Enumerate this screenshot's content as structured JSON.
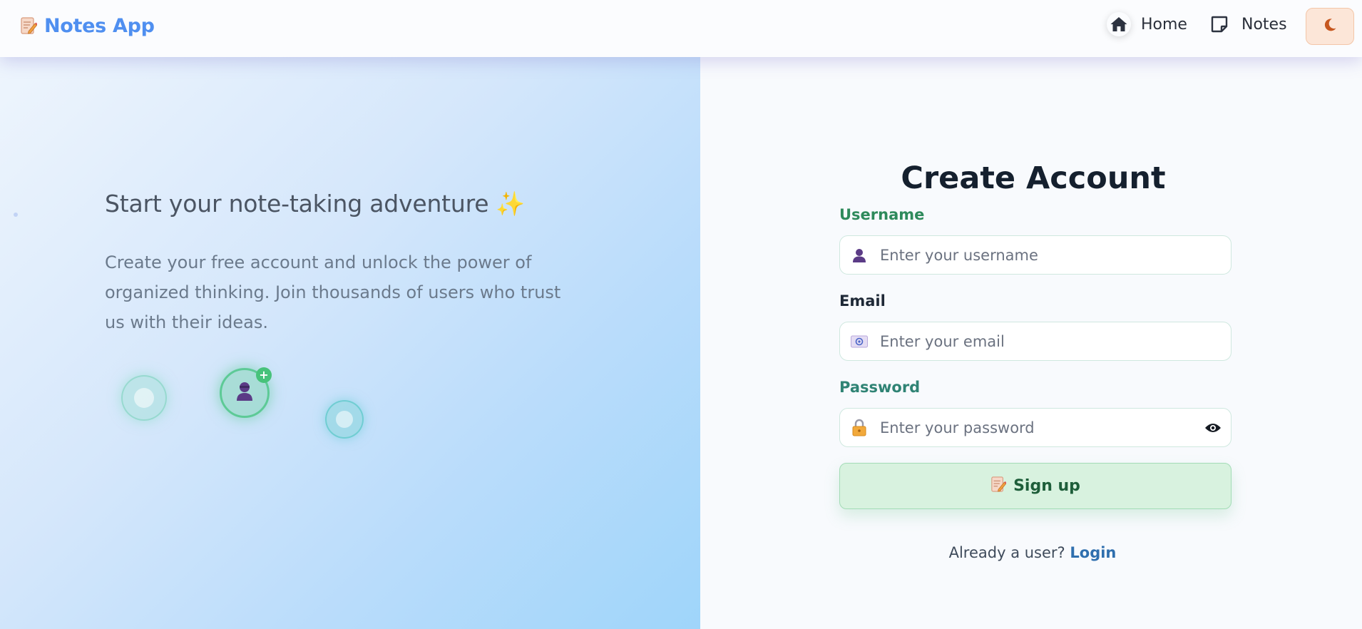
{
  "navbar": {
    "brand": {
      "icon": "memo-icon",
      "title": "Notes App"
    },
    "links": [
      {
        "icon": "house-icon",
        "label": "Home"
      },
      {
        "icon": "sticky-note-icon",
        "label": "Notes"
      }
    ],
    "theme_toggle": {
      "icon": "moon-icon"
    }
  },
  "hero": {
    "title": "Start your note-taking adventure",
    "title_emoji": "✨",
    "description": "Create your free account and unlock the power of organized thinking. Join thousands of users who trust us with their ideas.",
    "plus_badge": "+"
  },
  "form": {
    "title": "Create Account",
    "username": {
      "label": "Username",
      "value": "",
      "placeholder": "Enter your username",
      "icon": "user-icon"
    },
    "email": {
      "label": "Email",
      "value": "",
      "placeholder": "Enter your email",
      "icon": "email-icon"
    },
    "password": {
      "label": "Password",
      "value": "",
      "placeholder": "Enter your password",
      "icon": "lock-icon",
      "toggle_icon": "eye-icon"
    },
    "submit": {
      "label": "Sign up",
      "icon": "memo-icon"
    },
    "footer": {
      "text": "Already a user?",
      "link": "Login"
    }
  },
  "colors": {
    "brand": "#4f8ff0",
    "accent_green": "#2e8a5b",
    "button_bg": "#d8f2df",
    "link": "#2f6fae",
    "theme_toggle_bg": "#fce6d8"
  }
}
